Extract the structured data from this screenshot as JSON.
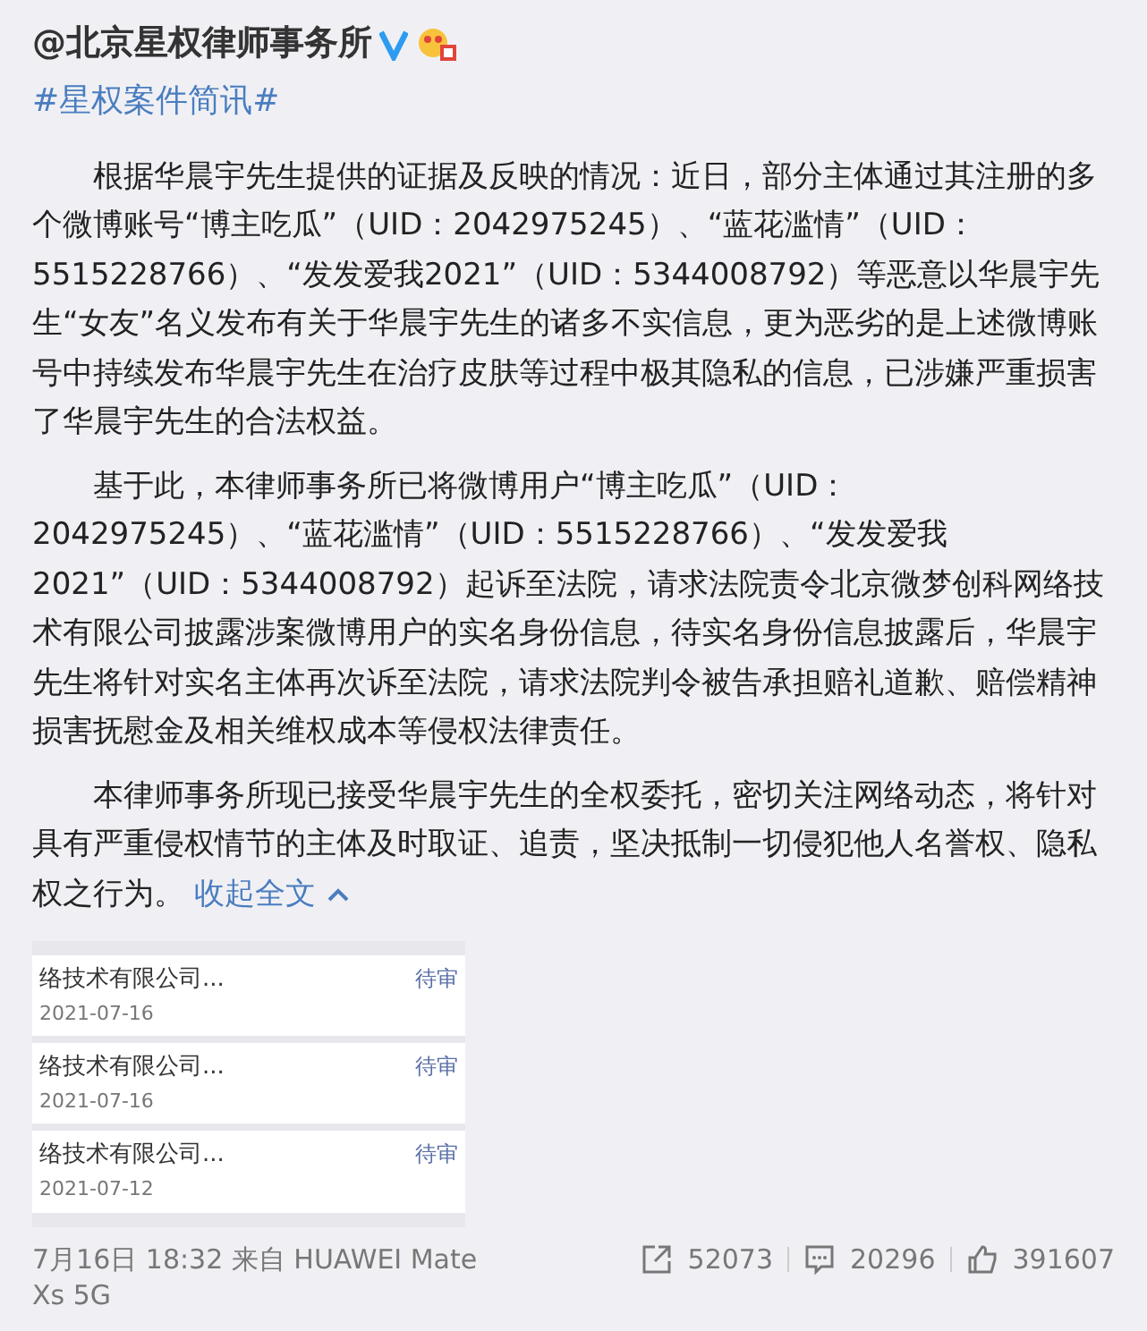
{
  "account": {
    "name": "@北京星权律师事务所",
    "verified": true
  },
  "hashtag": "#星权案件简讯#",
  "paragraphs": [
    "根据华晨宇先生提供的证据及反映的情况：近日，部分主体通过其注册的多个微博账号“博主吃瓜”（UID：2042975245）、“蓝花滥情”（UID：5515228766）、“发发爱我2021”（UID：5344008792）等恶意以华晨宇先生“女友”名义发布有关于华晨宇先生的诸多不实信息，更为恶劣的是上述微博账号中持续发布华晨宇先生在治疗皮肤等过程中极其隐私的信息，已涉嫌严重损害了华晨宇先生的合法权益。",
    "基于此，本律师事务所已将微博用户“博主吃瓜”（UID：2042975245）、“蓝花滥情”（UID：5515228766）、“发发爱我2021”（UID：5344008792）起诉至法院，请求法院责令北京微梦创科网络技术有限公司披露涉案微博用户的实名身份信息，待实名身份信息披露后，华晨宇先生将针对实名主体再次诉至法院，请求法院判令被告承担赔礼道歉、赔偿精神损害抚慰金及相关维权成本等侵权法律责任。",
    "本律师事务所现已接受华晨宇先生的全权委托，密切关注网络动态，将针对具有严重侵权情节的主体及时取证、追责，坚决抵制一切侵犯他人名誉权、隐私权之行为。"
  ],
  "collapse_link": "收起全文",
  "attached_image": {
    "rows": [
      {
        "title": "络技术有限公司...",
        "date": "2021-07-16",
        "status": "待审"
      },
      {
        "title": "络技术有限公司...",
        "date": "2021-07-16",
        "status": "待审"
      },
      {
        "title": "络技术有限公司...",
        "date": "2021-07-12",
        "status": "待审"
      }
    ]
  },
  "footer": {
    "source": "7月16日 18:32 来自 HUAWEI Mate Xs 5G",
    "reposts": "52073",
    "comments": "20296",
    "likes": "391607"
  }
}
